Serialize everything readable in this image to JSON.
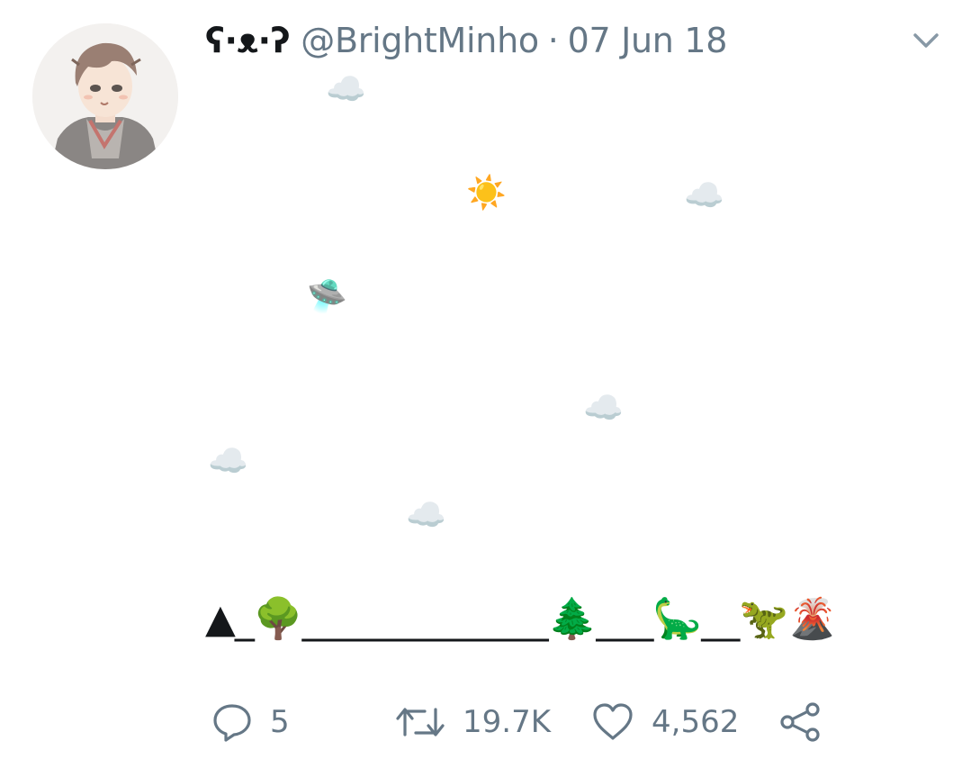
{
  "tweet": {
    "display_name": "ʕ·ᴥ·ʔ",
    "handle": "@BrightMinho",
    "separator": "·",
    "date": "07 Jun 18",
    "menu_icon": "chevron-down-icon",
    "avatar": "anime-boy-sketch-avatar",
    "emoji_scene": {
      "sky": [
        {
          "name": "cloud-emoji-1",
          "glyph": "☁️"
        },
        {
          "name": "sun-emoji",
          "glyph": "☀️"
        },
        {
          "name": "cloud-emoji-2",
          "glyph": "☁️"
        },
        {
          "name": "ufo-emoji",
          "glyph": "🛸"
        },
        {
          "name": "cloud-emoji-3",
          "glyph": "☁️"
        },
        {
          "name": "cloud-emoji-4",
          "glyph": "☁️"
        },
        {
          "name": "cloud-emoji-5",
          "glyph": "☁️"
        }
      ],
      "ground_line": "▲_🌳_____________🌲___🦕__🦖🌋"
    },
    "actions": {
      "replies": "5",
      "retweets": "19.7K",
      "likes": "4,562"
    }
  },
  "colors": {
    "text": "#14171a",
    "secondary": "#657786",
    "background": "#ffffff"
  }
}
